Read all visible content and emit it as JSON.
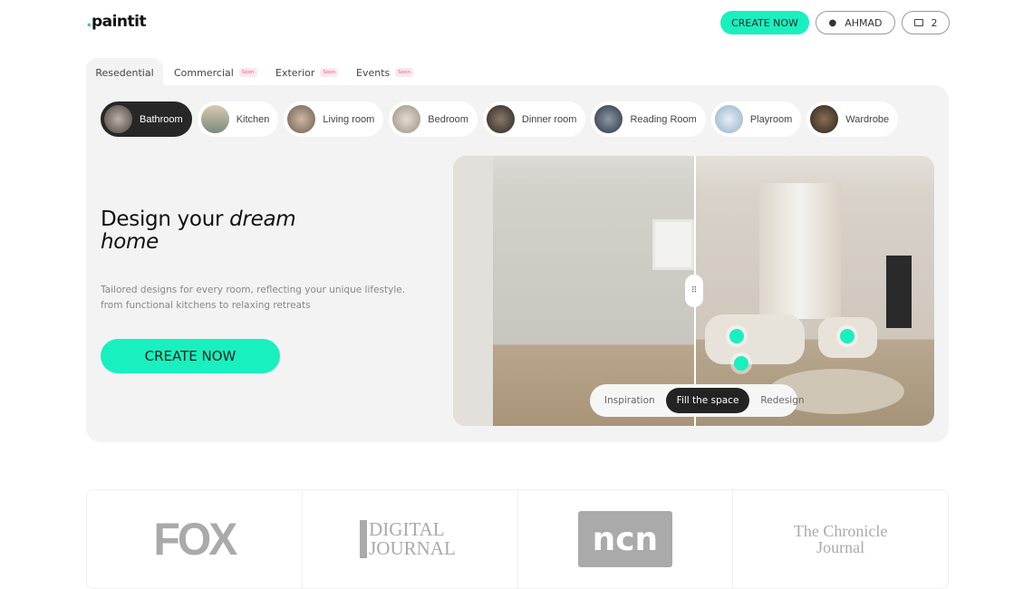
{
  "header": {
    "logo": "paintit",
    "create_label": "CREATE NOW",
    "user_label": "AHMAD",
    "gallery_count": "2"
  },
  "tabs": [
    {
      "label": "Resedential",
      "active": true
    },
    {
      "label": "Commercial",
      "badge": "Soon"
    },
    {
      "label": "Exterior",
      "badge": "Soon"
    },
    {
      "label": "Events",
      "badge": "Soon"
    }
  ],
  "rooms": [
    {
      "label": "Bathroom",
      "active": true
    },
    {
      "label": "Kitchen"
    },
    {
      "label": "Living room"
    },
    {
      "label": "Bedroom"
    },
    {
      "label": "Dinner room"
    },
    {
      "label": "Reading Room"
    },
    {
      "label": "Playroom"
    },
    {
      "label": "Wardrobe"
    }
  ],
  "hero": {
    "title_plain": "Design your ",
    "title_italic1": "dream",
    "title_italic2": "home",
    "description": "Tailored designs for every room, reflecting your unique lifestyle. from functional kitchens to relaxing retreats",
    "cta_label": "CREATE NOW"
  },
  "modes": {
    "options": [
      "Inspiration",
      "Fill the space",
      "Redesign"
    ],
    "selected": "Fill the space"
  },
  "press": [
    "FOX",
    "DIGITAL JOURNAL",
    "ncn",
    "The Chronicle Journal"
  ],
  "colors": {
    "accent": "#19f0bf",
    "dark": "#272727",
    "panel": "#f3f3f3"
  }
}
